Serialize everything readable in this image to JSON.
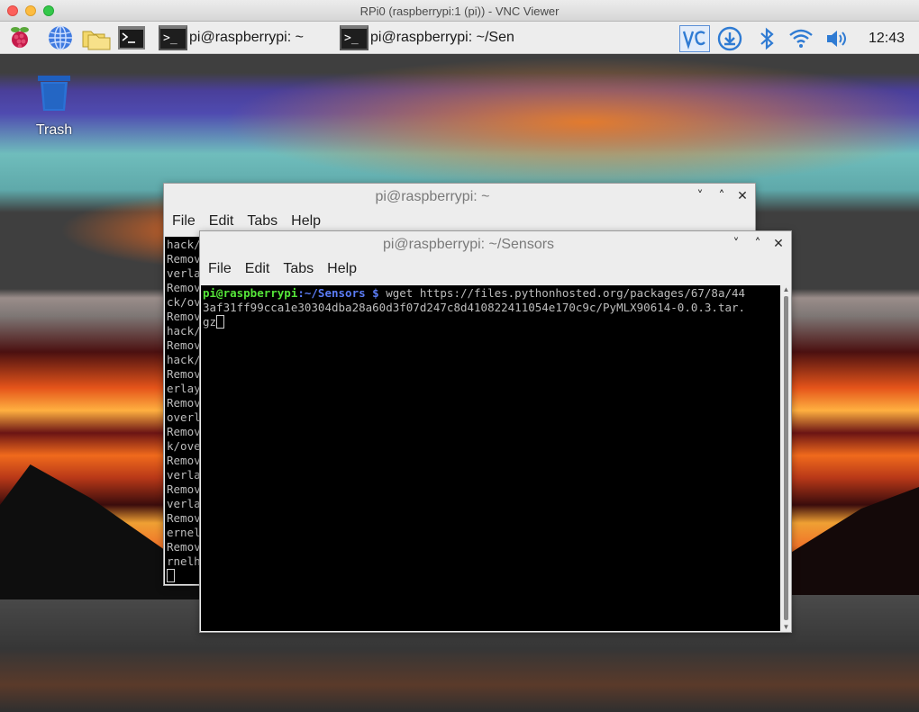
{
  "mac_window": {
    "title": "RPi0 (raspberrypi:1 (pi)) - VNC Viewer"
  },
  "panel": {
    "taskbar": [
      {
        "label": "pi@raspberrypi: ~",
        "icon": "terminal-icon"
      },
      {
        "label": "pi@raspberrypi: ~/Sen",
        "icon": "terminal-icon"
      }
    ],
    "launchers": [
      "raspberry-menu-icon",
      "web-browser-icon",
      "file-manager-icon",
      "terminal-icon"
    ],
    "tray": [
      "vnc-icon",
      "update-icon",
      "bluetooth-icon",
      "wifi-icon",
      "volume-icon"
    ],
    "clock": "12:43",
    "terminal_glyph": ">_"
  },
  "desktop": {
    "trash_label": "Trash"
  },
  "back_terminal": {
    "title": "pi@raspberrypi: ~",
    "menu": [
      "File",
      "Edit",
      "Tabs",
      "Help"
    ],
    "lines": [
      "hack/",
      "Remov",
      "verla",
      "Remov",
      "ck/ov",
      "Remov",
      "hack/",
      "Remov",
      "hack/",
      "Remov",
      "erlay",
      "Remov",
      "overl",
      "Remov",
      "k/ove",
      "Remov",
      "verla",
      "Remov",
      "verla",
      "Remov",
      "ernel",
      "Remov",
      "rnelh"
    ]
  },
  "front_terminal": {
    "title": "pi@raspberrypi: ~/Sensors",
    "menu": [
      "File",
      "Edit",
      "Tabs",
      "Help"
    ],
    "prompt_user": "pi@raspberrypi",
    "prompt_path": ":~/Sensors $",
    "command_line1": " wget https://files.pythonhosted.org/packages/67/8a/44",
    "command_line2": "3af31ff99cca1e30304dba28a60d3f07d247c8d410822411054e170c9c/PyMLX90614-0.0.3.tar.",
    "command_line3": "gz"
  },
  "colors": {
    "prompt_user": "#55e439",
    "prompt_path": "#5b7cf5",
    "terminal_bg": "#000000",
    "terminal_fg": "#bdbdbd"
  },
  "window_controls": {
    "minimize": "˅",
    "maximize": "˄",
    "close": "✕"
  }
}
